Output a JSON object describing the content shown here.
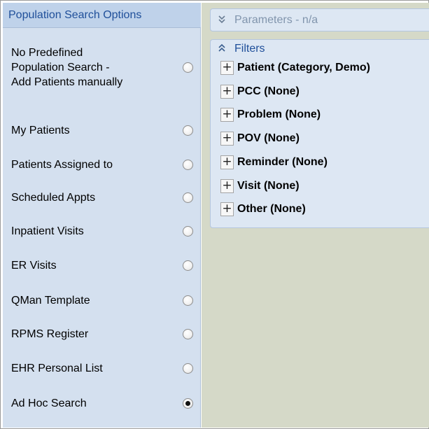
{
  "population": {
    "header": "Population Search Options",
    "options": [
      {
        "label": "No Predefined\nPopulation Search -\nAdd Patients manually",
        "selected": false
      },
      {
        "label": "My Patients",
        "selected": false
      },
      {
        "label": "Patients Assigned to",
        "selected": false
      },
      {
        "label": "Scheduled Appts",
        "selected": false
      },
      {
        "label": "Inpatient Visits",
        "selected": false
      },
      {
        "label": "ER Visits",
        "selected": false
      },
      {
        "label": "QMan Template",
        "selected": false
      },
      {
        "label": "RPMS Register",
        "selected": false
      },
      {
        "label": "EHR Personal List",
        "selected": false
      },
      {
        "label": "Ad Hoc Search",
        "selected": true
      }
    ]
  },
  "parameters": {
    "chevron_icon": "double-chevron-down-icon",
    "label": "Parameters - n/a"
  },
  "filters": {
    "chevron_icon": "double-chevron-up-icon",
    "title": "Filters",
    "expand_icon": "plus-icon",
    "items": [
      {
        "label": "Patient (Category, Demo)"
      },
      {
        "label": "PCC (None)"
      },
      {
        "label": "Problem (None)"
      },
      {
        "label": "POV (None)"
      },
      {
        "label": "Reminder (None)"
      },
      {
        "label": "Visit (None)"
      },
      {
        "label": "Other (None)"
      }
    ]
  }
}
